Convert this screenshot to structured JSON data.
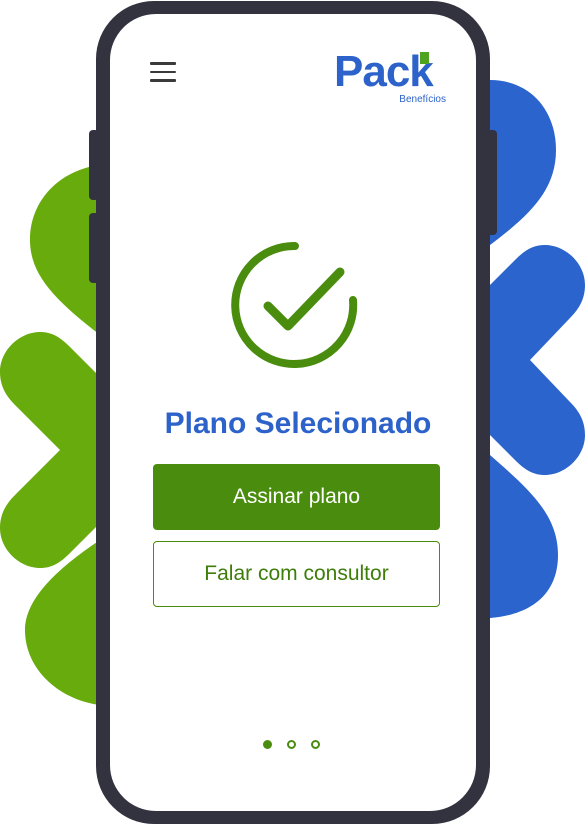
{
  "brand": {
    "name": "Pack",
    "subtitle": "Benefícios",
    "primary_color": "#2c62c9",
    "accent_color": "#4fa31e"
  },
  "header": {
    "menu_icon": "hamburger-menu-icon"
  },
  "status": {
    "icon": "check-circle-icon",
    "title": "Plano Selecionado"
  },
  "actions": {
    "primary_label": "Assinar plano",
    "secondary_label": "Falar com consultor",
    "primary_color": "#4a8c0d"
  },
  "pagination": {
    "total": 3,
    "active_index": 0
  },
  "decoration": {
    "left_shape_color": "#68ab0c",
    "right_shape_color": "#2a64cc"
  }
}
